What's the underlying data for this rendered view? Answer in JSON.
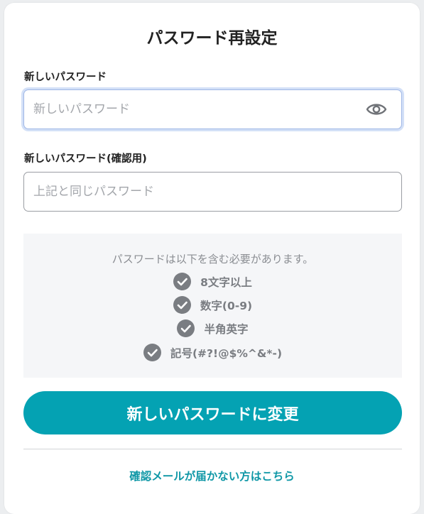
{
  "title": "パスワード再設定",
  "new_password": {
    "label": "新しいパスワード",
    "placeholder": "新しいパスワード",
    "value": "",
    "toggle_icon": "eye-icon"
  },
  "confirm_password": {
    "label": "新しいパスワード(確認用)",
    "placeholder": "上記と同じパスワード",
    "value": ""
  },
  "requirements": {
    "intro": "パスワードは以下を含む必要があります。",
    "icon": "check-circle-icon",
    "items": [
      "8文字以上",
      "数字(0-9)",
      "半角英字",
      "記号(#?!@$%^&*-)"
    ]
  },
  "submit_label": "新しいパスワードに変更",
  "resend_link": "確認メールが届かない方はこちら",
  "colors": {
    "primary": "#04a2b3",
    "link": "#0e97a6",
    "check": "#7a7d82"
  }
}
